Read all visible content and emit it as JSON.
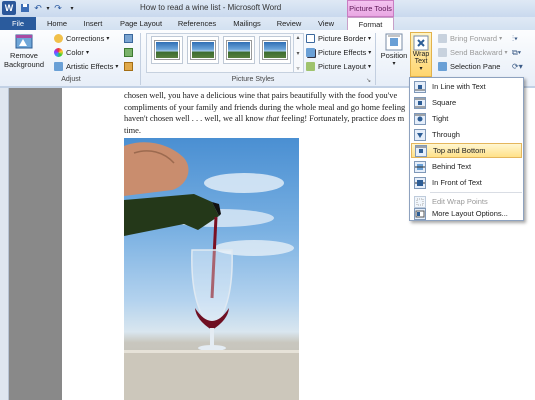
{
  "window": {
    "title": "How to read a wine list - Microsoft Word",
    "contextual_header": "Picture Tools"
  },
  "tabs": {
    "file": "File",
    "home": "Home",
    "insert": "Insert",
    "page_layout": "Page Layout",
    "references": "References",
    "mailings": "Mailings",
    "review": "Review",
    "view": "View",
    "format": "Format"
  },
  "adjust": {
    "remove_bg_line1": "Remove",
    "remove_bg_line2": "Background",
    "corrections": "Corrections",
    "color": "Color",
    "artistic": "Artistic Effects",
    "label": "Adjust"
  },
  "styles": {
    "label": "Picture Styles",
    "border": "Picture Border",
    "effects": "Picture Effects",
    "layout": "Picture Layout"
  },
  "arrange": {
    "position": "Position",
    "wrap_line1": "Wrap",
    "wrap_line2": "Text",
    "bring_forward": "Bring Forward",
    "send_backward": "Send Backward",
    "selection_pane": "Selection Pane"
  },
  "document": {
    "line1": "chosen well, you have a delicious wine that pairs beautifully with the food you've",
    "line2": "compliments of your family and friends during the whole meal and go home feeling",
    "line3a": "haven't chosen well . . . well, we all know ",
    "line3_em": "that",
    "line3b": " feeling! Fortunately, practice ",
    "line3_em2": "does",
    "line3c": " m",
    "line4": "time."
  },
  "wrap_menu": {
    "items": [
      {
        "label": "In Line with Text"
      },
      {
        "label": "Square"
      },
      {
        "label": "Tight"
      },
      {
        "label": "Through"
      },
      {
        "label": "Top and Bottom"
      },
      {
        "label": "Behind Text"
      },
      {
        "label": "In Front of Text"
      },
      {
        "label": "Edit Wrap Points"
      },
      {
        "label": "More Layout Options..."
      }
    ],
    "highlighted_index": 4,
    "disabled_index": 7
  },
  "colors": {
    "file_tab": "#2a5b9d",
    "contextual": "#e9a7e3",
    "highlight": "#ffe189"
  }
}
